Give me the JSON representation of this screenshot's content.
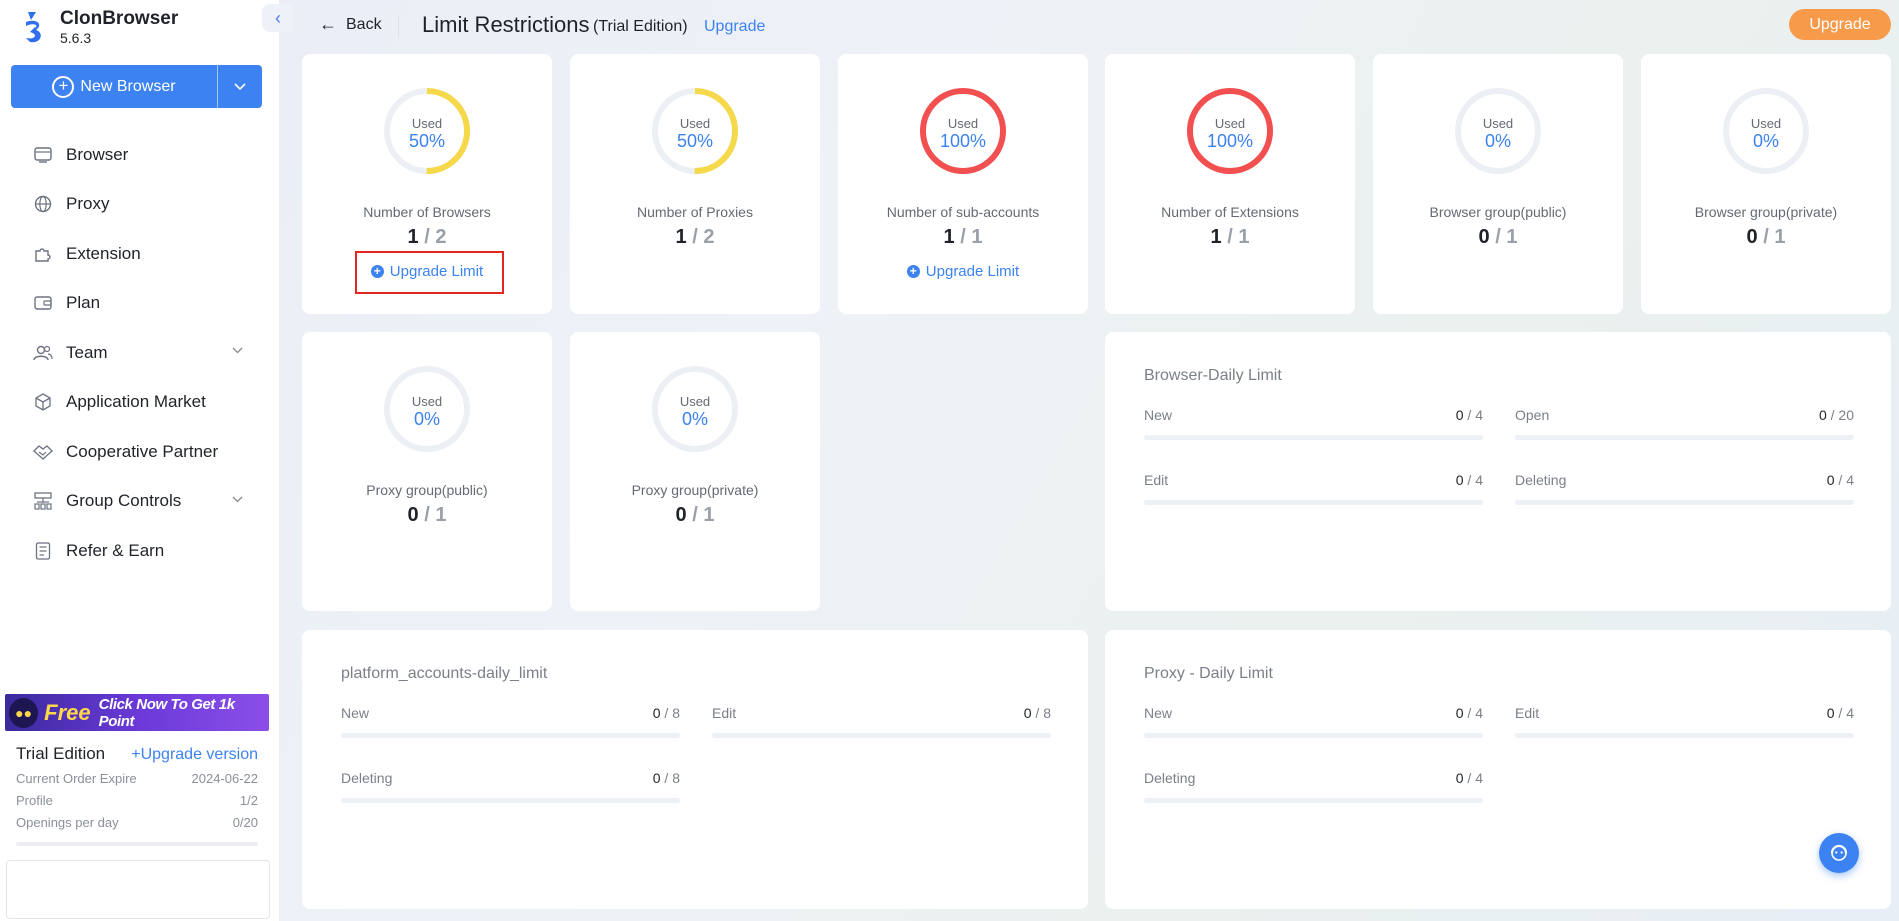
{
  "app": {
    "name": "ClonBrowser",
    "version": "5.6.3"
  },
  "sidebar": {
    "new_browser_label": "New Browser",
    "items": [
      {
        "label": "Browser",
        "icon": "browser-icon"
      },
      {
        "label": "Proxy",
        "icon": "globe-icon"
      },
      {
        "label": "Extension",
        "icon": "puzzle-icon"
      },
      {
        "label": "Plan",
        "icon": "wallet-icon"
      },
      {
        "label": "Team",
        "icon": "team-icon",
        "has_children": true
      },
      {
        "label": "Application Market",
        "icon": "cube-icon"
      },
      {
        "label": "Cooperative Partner",
        "icon": "handshake-icon"
      },
      {
        "label": "Group Controls",
        "icon": "sitemap-icon",
        "has_children": true
      },
      {
        "label": "Refer & Earn",
        "icon": "document-icon"
      }
    ],
    "promo": {
      "free": "Free",
      "text": "Click Now To Get 1k Point"
    },
    "plan": {
      "title": "Trial Edition",
      "upgrade": "+Upgrade version",
      "rows": [
        {
          "label": "Current Order Expire",
          "value": "2024-06-22"
        },
        {
          "label": "Profile",
          "value": "1/2"
        },
        {
          "label": "Openings per day",
          "value": "0/20"
        }
      ]
    }
  },
  "header": {
    "back": "Back",
    "title": "Limit Restrictions",
    "subtitle": "(Trial Edition)",
    "upgrade_link": "Upgrade",
    "upgrade_button": "Upgrade"
  },
  "stats": [
    {
      "used_label": "Used",
      "percent": "50%",
      "fraction": 0.5,
      "color": "#f5d94a",
      "label": "Number of Browsers",
      "used": "1",
      "total": "2",
      "upgrade_limit": "Upgrade Limit"
    },
    {
      "used_label": "Used",
      "percent": "50%",
      "fraction": 0.5,
      "color": "#f5d94a",
      "label": "Number of Proxies",
      "used": "1",
      "total": "2"
    },
    {
      "used_label": "Used",
      "percent": "100%",
      "fraction": 1.0,
      "color": "#f25050",
      "label": "Number of sub-accounts",
      "used": "1",
      "total": "1",
      "upgrade_limit": "Upgrade Limit"
    },
    {
      "used_label": "Used",
      "percent": "100%",
      "fraction": 1.0,
      "color": "#f25050",
      "label": "Number of Extensions",
      "used": "1",
      "total": "1"
    },
    {
      "used_label": "Used",
      "percent": "0%",
      "fraction": 0,
      "color": "#3c82f0",
      "label": "Browser group(public)",
      "used": "0",
      "total": "1"
    },
    {
      "used_label": "Used",
      "percent": "0%",
      "fraction": 0,
      "color": "#3c82f0",
      "label": "Browser group(private)",
      "used": "0",
      "total": "1"
    },
    {
      "used_label": "Used",
      "percent": "0%",
      "fraction": 0,
      "color": "#3c82f0",
      "label": "Proxy group(public)",
      "used": "0",
      "total": "1"
    },
    {
      "used_label": "Used",
      "percent": "0%",
      "fraction": 0,
      "color": "#3c82f0",
      "label": "Proxy group(private)",
      "used": "0",
      "total": "1"
    }
  ],
  "browser_daily": {
    "title": "Browser-Daily Limit",
    "items": [
      {
        "label": "New",
        "used": "0",
        "total": "4"
      },
      {
        "label": "Open",
        "used": "0",
        "total": "20"
      },
      {
        "label": "Edit",
        "used": "0",
        "total": "4"
      },
      {
        "label": "Deleting",
        "used": "0",
        "total": "4"
      }
    ]
  },
  "platform_daily": {
    "title": "platform_accounts-daily_limit",
    "items": [
      {
        "label": "New",
        "used": "0",
        "total": "8"
      },
      {
        "label": "Edit",
        "used": "0",
        "total": "8"
      },
      {
        "label": "Deleting",
        "used": "0",
        "total": "8"
      }
    ]
  },
  "proxy_daily": {
    "title": "Proxy - Daily Limit",
    "items": [
      {
        "label": "New",
        "used": "0",
        "total": "4"
      },
      {
        "label": "Edit",
        "used": "0",
        "total": "4"
      },
      {
        "label": "Deleting",
        "used": "0",
        "total": "4"
      }
    ]
  }
}
